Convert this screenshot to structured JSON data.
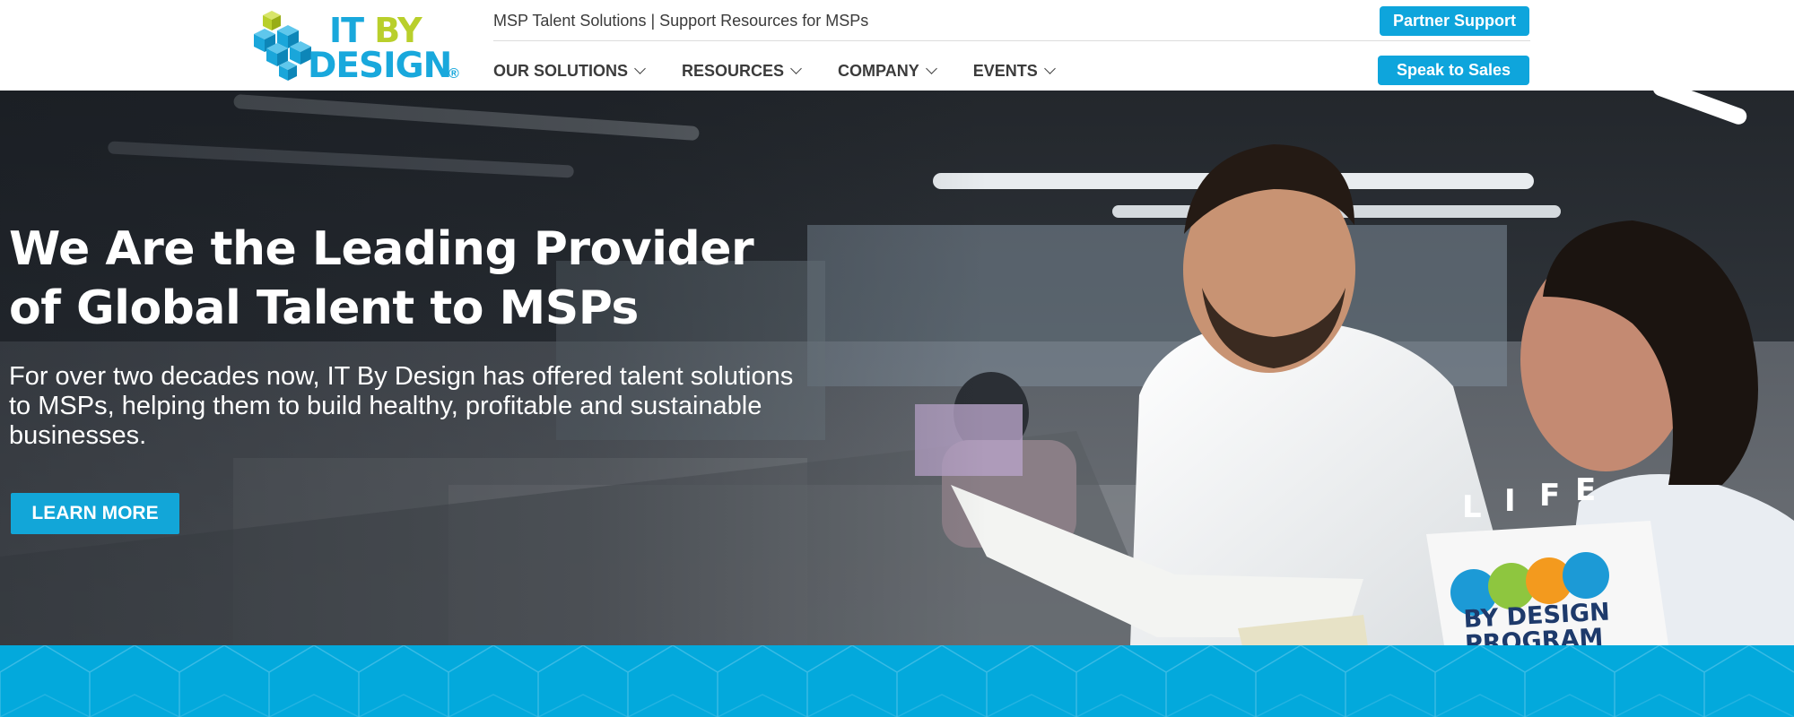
{
  "header": {
    "logo": {
      "line1_it": "IT",
      "line1_by": "BY",
      "line2": "DESIGN",
      "reg": "®"
    },
    "tagline": "MSP Talent Solutions | Support Resources for MSPs",
    "partner_support_label": "Partner Support",
    "speak_to_sales_label": "Speak to Sales",
    "nav": [
      {
        "label": "OUR SOLUTIONS"
      },
      {
        "label": "RESOURCES"
      },
      {
        "label": "COMPANY"
      },
      {
        "label": "EVENTS"
      }
    ]
  },
  "hero": {
    "title_line1": "We Are the Leading Provider",
    "title_line2": "of Global Talent to MSPs",
    "subtitle": "For over two decades now, IT By Design has offered talent solutions to MSPs, helping them to build healthy, profitable and sustainable businesses.",
    "cta_label": "LEARN MORE",
    "binder_text": {
      "letters": [
        "L",
        "I",
        "F",
        "E"
      ],
      "line2": "BY DESIGN",
      "line3": "PROGRAM"
    }
  },
  "colors": {
    "brand_blue": "#19a8dc",
    "brand_green": "#b9cf2b",
    "button_blue": "#0ea5dc",
    "band_blue": "#03a9dc"
  },
  "icons": {
    "nav_chevron": "chevron-down-icon",
    "logo": "stacked-cubes-logo"
  }
}
